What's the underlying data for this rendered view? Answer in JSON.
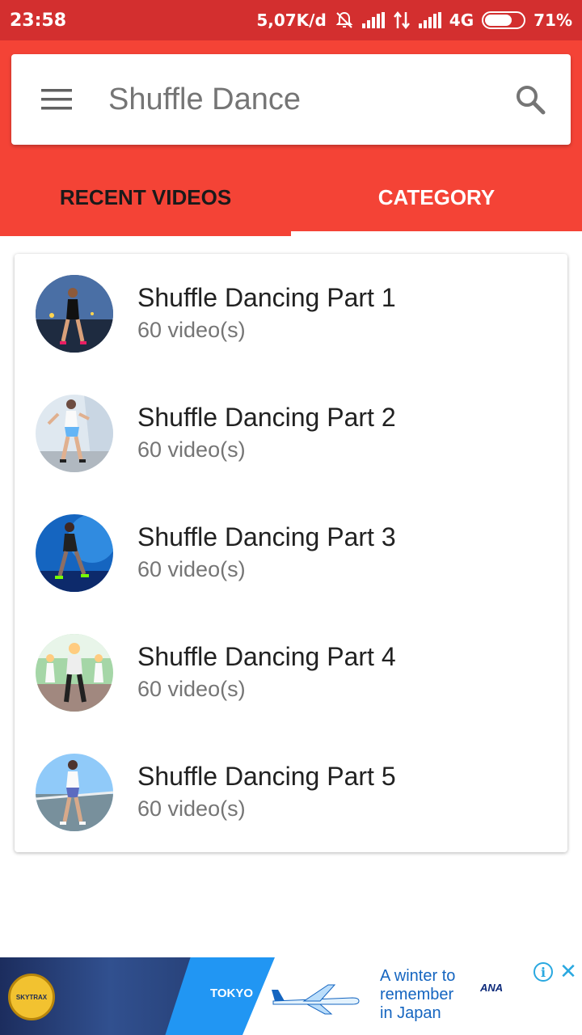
{
  "status_bar": {
    "time": "23:58",
    "network_speed": "5,07K/d",
    "network_type": "4G",
    "battery": "71%",
    "battery_level": 0.71,
    "icons": [
      "notifications-off-icon",
      "signal-icon",
      "data-transfer-icon",
      "signal-icon",
      "battery-icon"
    ]
  },
  "header": {
    "title": "Shuffle Dance",
    "menu_icon": "hamburger-menu-icon",
    "search_icon": "search-icon",
    "accent_color": "#f44336",
    "status_color": "#d32f2f"
  },
  "tabs": [
    {
      "label": "RECENT VIDEOS",
      "selected": false
    },
    {
      "label": "CATEGORY",
      "selected": true
    }
  ],
  "categories": [
    {
      "title": "Shuffle Dancing Part 1",
      "count": "60 video(s)"
    },
    {
      "title": "Shuffle Dancing Part 2",
      "count": "60 video(s)"
    },
    {
      "title": "Shuffle Dancing Part 3",
      "count": "60 video(s)"
    },
    {
      "title": "Shuffle Dancing Part 4",
      "count": "60 video(s)"
    },
    {
      "title": "Shuffle Dancing Part 5",
      "count": "60 video(s)"
    }
  ],
  "ad": {
    "headline_lines": [
      "A winter to",
      "remember",
      "in Japan"
    ],
    "tokyo_label": "TOKYO",
    "brand": "ANA",
    "info_icon": "info-icon",
    "close_icon": "close-icon"
  }
}
